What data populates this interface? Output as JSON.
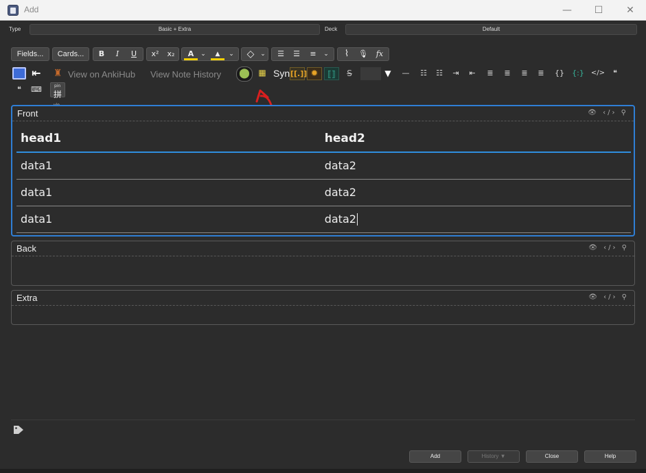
{
  "window": {
    "title": "Add",
    "min_glyph": "—",
    "max_glyph": "☐",
    "close_glyph": "✕"
  },
  "note_type": {
    "label": "Type",
    "value": "Basic + Extra"
  },
  "deck": {
    "label": "Deck",
    "value": "Default"
  },
  "toolbar": {
    "fields_label": "Fields...",
    "cards_label": "Cards...",
    "bold": "B",
    "italic": "I",
    "underline": "U",
    "superscript": "x²",
    "subscript": "x₂",
    "text_color": "A",
    "highlight": "▲",
    "eraser": "◇",
    "bullets": "☰",
    "numbers": "☰",
    "align": "≡",
    "attach": "⌇",
    "record": "🎙",
    "math": "fx",
    "dropdown": "⌄",
    "text_color_hex": "#f4d000",
    "highlight_hex": "#f4d000"
  },
  "toolbar2": {
    "view_ankihub": "View on AnkiHub",
    "view_history": "View Note History",
    "syn": "Syn",
    "cloze1": "[[.]]",
    "pinyin_top": "pin",
    "pinyin_char": "拼",
    "yin_top": "yin",
    "yin_char": "音",
    "quote1": "❝",
    "braces": "{}",
    "code": "</>",
    "quote2": "❝",
    "triangle": "▼",
    "dash": "—"
  },
  "fields": [
    {
      "name": "Front",
      "icons": "👁 ‹/› ⚲"
    },
    {
      "name": "Back",
      "icons": "👁 ‹/› ⚲"
    },
    {
      "name": "Extra",
      "icons": "👁 ‹/› ⚲"
    }
  ],
  "table": {
    "headers": [
      "head1",
      "head2"
    ],
    "rows": [
      [
        "data1",
        "data2"
      ],
      [
        "data1",
        "data2"
      ],
      [
        "data1",
        "data2"
      ]
    ]
  },
  "annotation_color": "#d91f1f",
  "bottom": {
    "add": "Add",
    "history": "History ▼",
    "close": "Close",
    "help": "Help"
  }
}
